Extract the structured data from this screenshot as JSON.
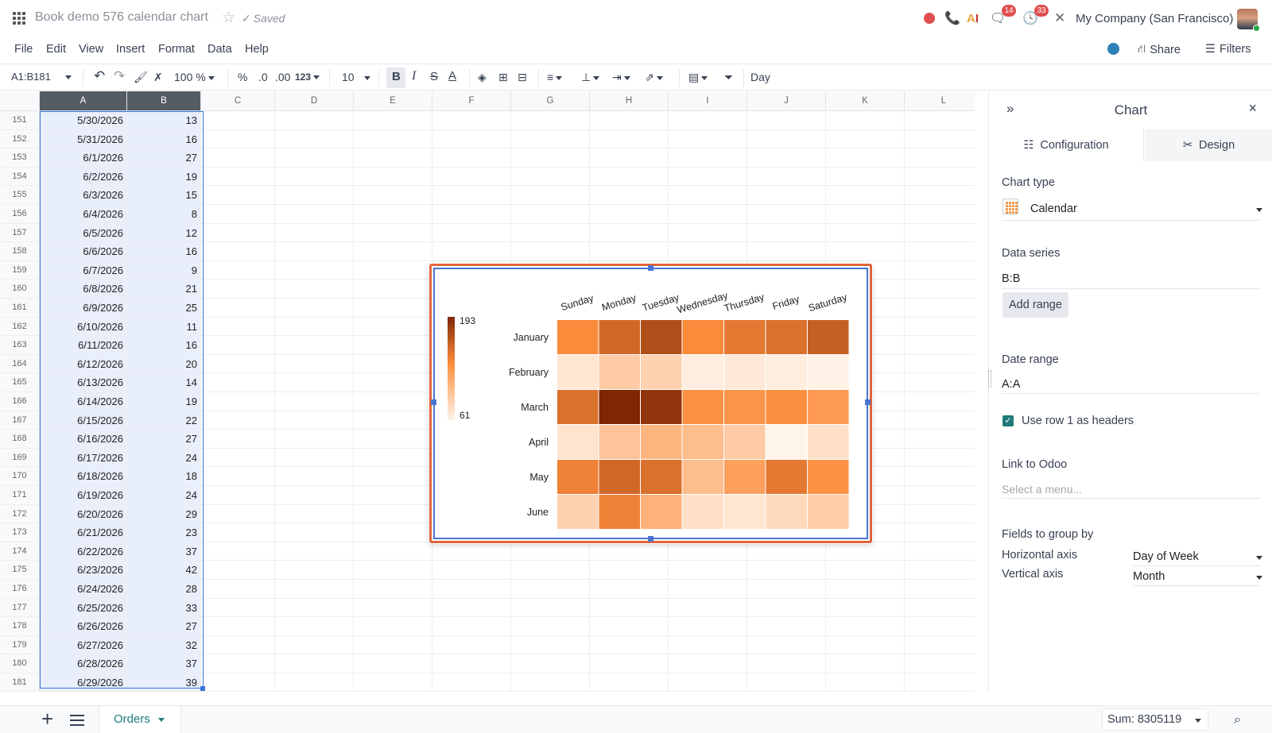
{
  "header": {
    "doc_title": "Book demo 576 calendar chart",
    "saved_label": "Saved",
    "badge_discuss": "14",
    "badge_activity": "33",
    "company": "My Company (San Francisco)"
  },
  "menu": {
    "items": [
      "File",
      "Edit",
      "View",
      "Insert",
      "Format",
      "Data",
      "Help"
    ],
    "share": "Share",
    "filters": "Filters"
  },
  "toolbar": {
    "range": "A1:B181",
    "zoom": "100 %",
    "percent": "%",
    "dec_decrease": ".0",
    "dec_increase": ".00",
    "format_123": "123",
    "font_size": "10",
    "formula": "Day"
  },
  "grid": {
    "columns": [
      "A",
      "B",
      "C",
      "D",
      "E",
      "F",
      "G",
      "H",
      "I",
      "J",
      "K",
      "L"
    ],
    "rows": [
      {
        "n": "151",
        "a": "5/30/2026",
        "b": "13"
      },
      {
        "n": "152",
        "a": "5/31/2026",
        "b": "16"
      },
      {
        "n": "153",
        "a": "6/1/2026",
        "b": "27"
      },
      {
        "n": "154",
        "a": "6/2/2026",
        "b": "19"
      },
      {
        "n": "155",
        "a": "6/3/2026",
        "b": "15"
      },
      {
        "n": "156",
        "a": "6/4/2026",
        "b": "8"
      },
      {
        "n": "157",
        "a": "6/5/2026",
        "b": "12"
      },
      {
        "n": "158",
        "a": "6/6/2026",
        "b": "16"
      },
      {
        "n": "159",
        "a": "6/7/2026",
        "b": "9"
      },
      {
        "n": "160",
        "a": "6/8/2026",
        "b": "21"
      },
      {
        "n": "161",
        "a": "6/9/2026",
        "b": "25"
      },
      {
        "n": "162",
        "a": "6/10/2026",
        "b": "11"
      },
      {
        "n": "163",
        "a": "6/11/2026",
        "b": "16"
      },
      {
        "n": "164",
        "a": "6/12/2026",
        "b": "20"
      },
      {
        "n": "165",
        "a": "6/13/2026",
        "b": "14"
      },
      {
        "n": "166",
        "a": "6/14/2026",
        "b": "19"
      },
      {
        "n": "167",
        "a": "6/15/2026",
        "b": "22"
      },
      {
        "n": "168",
        "a": "6/16/2026",
        "b": "27"
      },
      {
        "n": "169",
        "a": "6/17/2026",
        "b": "24"
      },
      {
        "n": "170",
        "a": "6/18/2026",
        "b": "18"
      },
      {
        "n": "171",
        "a": "6/19/2026",
        "b": "24"
      },
      {
        "n": "172",
        "a": "6/20/2026",
        "b": "29"
      },
      {
        "n": "173",
        "a": "6/21/2026",
        "b": "23"
      },
      {
        "n": "174",
        "a": "6/22/2026",
        "b": "37"
      },
      {
        "n": "175",
        "a": "6/23/2026",
        "b": "42"
      },
      {
        "n": "176",
        "a": "6/24/2026",
        "b": "28"
      },
      {
        "n": "177",
        "a": "6/25/2026",
        "b": "33"
      },
      {
        "n": "178",
        "a": "6/26/2026",
        "b": "27"
      },
      {
        "n": "179",
        "a": "6/27/2026",
        "b": "32"
      },
      {
        "n": "180",
        "a": "6/28/2026",
        "b": "37"
      },
      {
        "n": "181",
        "a": "6/29/2026",
        "b": "39"
      }
    ]
  },
  "chart_data": {
    "type": "heatmap",
    "x_categories": [
      "Sunday",
      "Monday",
      "Tuesday",
      "Wednesday",
      "Thursday",
      "Friday",
      "Saturday"
    ],
    "y_categories": [
      "January",
      "February",
      "March",
      "April",
      "May",
      "June"
    ],
    "values": [
      [
        135,
        155,
        170,
        135,
        145,
        150,
        160
      ],
      [
        70,
        90,
        85,
        65,
        68,
        66,
        63
      ],
      [
        150,
        193,
        185,
        130,
        128,
        132,
        125
      ],
      [
        72,
        95,
        105,
        100,
        90,
        61,
        75
      ],
      [
        140,
        155,
        150,
        100,
        120,
        145,
        130
      ],
      [
        85,
        140,
        108,
        75,
        70,
        80,
        88
      ]
    ],
    "color_min": "#fff4ea",
    "color_max": "#7f2704",
    "scale_min": 61,
    "scale_max": 193,
    "legend_labels": [
      "193",
      "61"
    ],
    "legend_placement": "left"
  },
  "panel": {
    "title": "Chart",
    "tab_config": "Configuration",
    "tab_design": "Design",
    "chart_type_label": "Chart type",
    "chart_type_value": "Calendar",
    "data_series_label": "Data series",
    "data_series_value": "B:B",
    "add_range": "Add range",
    "date_range_label": "Date range",
    "date_range_value": "A:A",
    "use_headers": "Use row 1 as headers",
    "link_label": "Link to Odoo",
    "link_placeholder": "Select a menu...",
    "group_label": "Fields to group by",
    "h_axis_label": "Horizontal axis",
    "h_axis_value": "Day of Week",
    "v_axis_label": "Vertical axis",
    "v_axis_value": "Month"
  },
  "footer": {
    "sheet_name": "Orders",
    "sum": "Sum: 8305119"
  },
  "colors": {
    "accent": "#1f7a7a",
    "selection": "#3b74d9",
    "chart_border": "#e2643b",
    "badge": "#e04f4f"
  }
}
